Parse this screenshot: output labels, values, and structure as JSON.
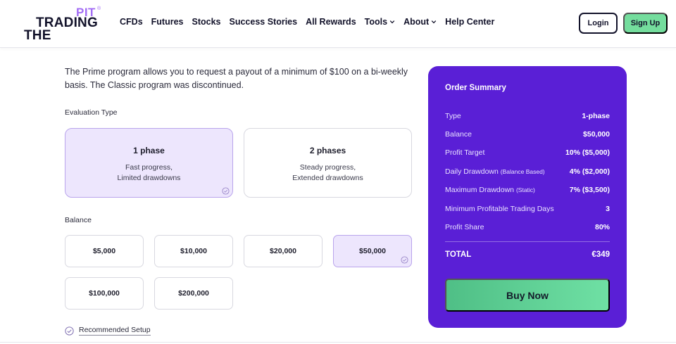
{
  "logo": {
    "line1": "PIT",
    "reg": "®",
    "line2": "TRADING",
    "line3": "THE"
  },
  "nav": {
    "items": [
      {
        "label": "CFDs",
        "dropdown": false
      },
      {
        "label": "Futures",
        "dropdown": false
      },
      {
        "label": "Stocks",
        "dropdown": false
      },
      {
        "label": "Success Stories",
        "dropdown": false
      },
      {
        "label": "All Rewards",
        "dropdown": false
      },
      {
        "label": "Tools",
        "dropdown": true
      },
      {
        "label": "About",
        "dropdown": true
      },
      {
        "label": "Help Center",
        "dropdown": false
      }
    ],
    "login": "Login",
    "signup": "Sign Up"
  },
  "intro": "The Prime program allows you to request a payout of a minimum of $100 on a bi-weekly basis. The Classic program was discontinued.",
  "evaluation": {
    "label": "Evaluation Type",
    "options": [
      {
        "title": "1 phase",
        "desc1": "Fast progress,",
        "desc2": "Limited drawdowns",
        "selected": true
      },
      {
        "title": "2 phases",
        "desc1": "Steady progress,",
        "desc2": "Extended drawdowns",
        "selected": false
      }
    ]
  },
  "balance": {
    "label": "Balance",
    "options": [
      {
        "label": "$5,000",
        "selected": false
      },
      {
        "label": "$10,000",
        "selected": false
      },
      {
        "label": "$20,000",
        "selected": false
      },
      {
        "label": "$50,000",
        "selected": true
      },
      {
        "label": "$100,000",
        "selected": false
      },
      {
        "label": "$200,000",
        "selected": false
      }
    ]
  },
  "recommended": "Recommended Setup",
  "summary": {
    "title": "Order Summary",
    "rows": [
      {
        "label": "Type",
        "sub": "",
        "value": "1-phase"
      },
      {
        "label": "Balance",
        "sub": "",
        "value": "$50,000"
      },
      {
        "label": "Profit Target",
        "sub": "",
        "value": "10% ($5,000)"
      },
      {
        "label": "Daily Drawdown",
        "sub": "(Balance Based)",
        "value": "4% ($2,000)"
      },
      {
        "label": "Maximum Drawdown",
        "sub": "(Static)",
        "value": "7% ($3,500)"
      },
      {
        "label": "Minimum Profitable Trading Days",
        "sub": "",
        "value": "3"
      },
      {
        "label": "Profit Share",
        "sub": "",
        "value": "80%"
      }
    ],
    "total_label": "TOTAL",
    "total_value": "€349",
    "buy_label": "Buy Now"
  },
  "colors": {
    "accent_purple": "#5a1fd6",
    "selected_bg": "#ede6fd",
    "signup_green": "#74dd9d",
    "logo_purple": "#a36df5"
  }
}
